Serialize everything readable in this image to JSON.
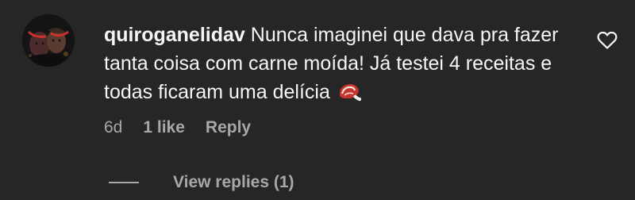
{
  "comment": {
    "username": "quiroganelidav",
    "text": "Nunca imaginei que dava pra fazer tanta coisa com carne moída! Já testei 4 receitas e todas ficaram uma delícia",
    "emoji_icon": "meat-emoji-icon",
    "like_icon": "heart-outline-icon",
    "time": "6d",
    "likes": "1 like",
    "reply_label": "Reply",
    "view_replies_label": "View replies (1)"
  },
  "colors": {
    "background": "#262626",
    "text_primary": "#f5f5f5",
    "text_secondary": "#a8a8a8"
  }
}
